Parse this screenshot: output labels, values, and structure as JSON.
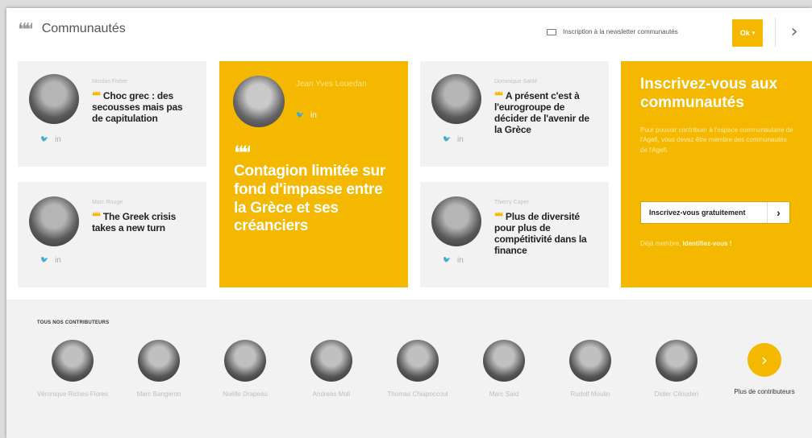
{
  "header": {
    "title": "Communautés",
    "quote_glyph": "❝❝",
    "newsletter": "Inscription à la newsletter communautés",
    "ok": "Ok",
    "next": "›"
  },
  "cards": [
    {
      "author": "Nicolas Fisher",
      "headline": "Choc grec : des secousses mais pas de capitulation"
    },
    {
      "author": "Marc Rouge",
      "headline": "The Greek crisis takes a new turn"
    },
    {
      "author": "Dominique Sahlé",
      "headline": "A présent c'est à l'eurogroupe de décider de l'avenir de la Grèce"
    },
    {
      "author": "Thierry Capet",
      "headline": "Plus de diversité pour plus de compétitivité dans la finance"
    }
  ],
  "feature": {
    "author": "Jean Yves Louedan",
    "headline": "Contagion limitée sur fond d'impasse entre la Grèce et ses créanciers"
  },
  "social": {
    "twitter": "🐦",
    "linkedin": "in"
  },
  "signup": {
    "title": "Inscrivez-vous aux communautés",
    "body": "Pour pouvoir contribuer à l'espace communautaire de l'Agefi, vous devez être membre des communautés de l'Agefi.",
    "button": "Inscrivez-vous gratuitement",
    "button_arrow": "›",
    "login_prefix": "Déjà membre,",
    "login_link": "Identifiez-vous !"
  },
  "contributors": {
    "label": "TOUS NOS CONTRIBUTEURS",
    "people": [
      {
        "name": "Véronique Riches-Flores"
      },
      {
        "name": "Marc Bangeron"
      },
      {
        "name": "Noëlle Drapeau"
      },
      {
        "name": "Andreas Moll"
      },
      {
        "name": "Thomas Chiapoccoul"
      },
      {
        "name": "Marc Saïd"
      },
      {
        "name": "Rudolf Moulin"
      },
      {
        "name": "Didier Cilouden"
      }
    ],
    "more_label": "Plus de contributeurs",
    "more_arrow": "›"
  },
  "colors": {
    "accent": "#f5b800",
    "card": "#f2f2f2"
  }
}
